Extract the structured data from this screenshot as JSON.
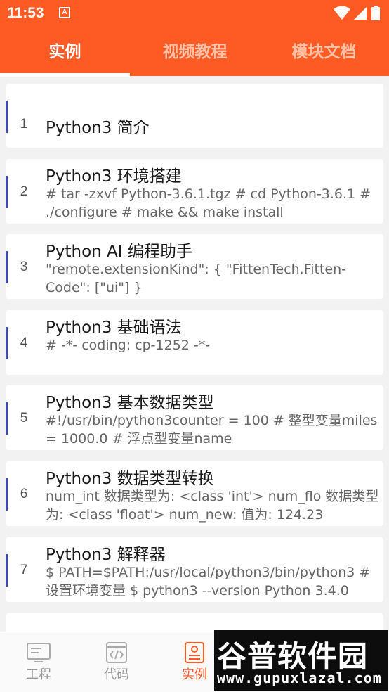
{
  "status_bar": {
    "time": "11:53",
    "app_icon_letter": "A",
    "icons": [
      "wifi-icon",
      "signal-icon",
      "battery-icon"
    ]
  },
  "tabs": [
    {
      "label": "实例",
      "active": true
    },
    {
      "label": "视频教程",
      "active": false
    },
    {
      "label": "模块文档",
      "active": false
    }
  ],
  "list": {
    "items": [
      {
        "num": "1",
        "title": "Python3 简介",
        "desc": ""
      },
      {
        "num": "2",
        "title": "Python3 环境搭建",
        "desc": "# tar -zxvf Python-3.6.1.tgz # cd Python-3.6.1 # ./configure # make && make install"
      },
      {
        "num": "3",
        "title": "Python AI 编程助手",
        "desc": "\"remote.extensionKind\": { \"FittenTech.Fitten-Code\": [\"ui\"] }"
      },
      {
        "num": "4",
        "title": "Python3 基础语法",
        "desc": "# -*- coding: cp-1252 -*-"
      },
      {
        "num": "5",
        "title": "Python3 基本数据类型",
        "desc": "#!/usr/bin/python3counter = 100          # 整型变量miles   = 1000.0       # 浮点型变量name"
      },
      {
        "num": "6",
        "title": "Python3 数据类型转换",
        "desc": "num_int 数据类型为: <class 'int'> num_flo 数据类型为: <class 'float'> num_new: 值为: 124.23"
      },
      {
        "num": "7",
        "title": "Python3 解释器",
        "desc": "$ PATH=$PATH:/usr/local/python3/bin/python3 # 设置环境变量 $ python3 --version Python 3.4.0"
      }
    ]
  },
  "bottom_nav": [
    {
      "label": "工程",
      "icon": "project-icon",
      "active": false
    },
    {
      "label": "代码",
      "icon": "code-icon",
      "active": false
    },
    {
      "label": "实例",
      "icon": "examples-icon",
      "active": true
    }
  ],
  "watermark": {
    "cn": "谷普软件园",
    "en": "www.gupuxlazal.com"
  },
  "colors": {
    "accent": "#fe5a23",
    "indicator": "#3d4db5",
    "background": "#f2f2f2"
  }
}
